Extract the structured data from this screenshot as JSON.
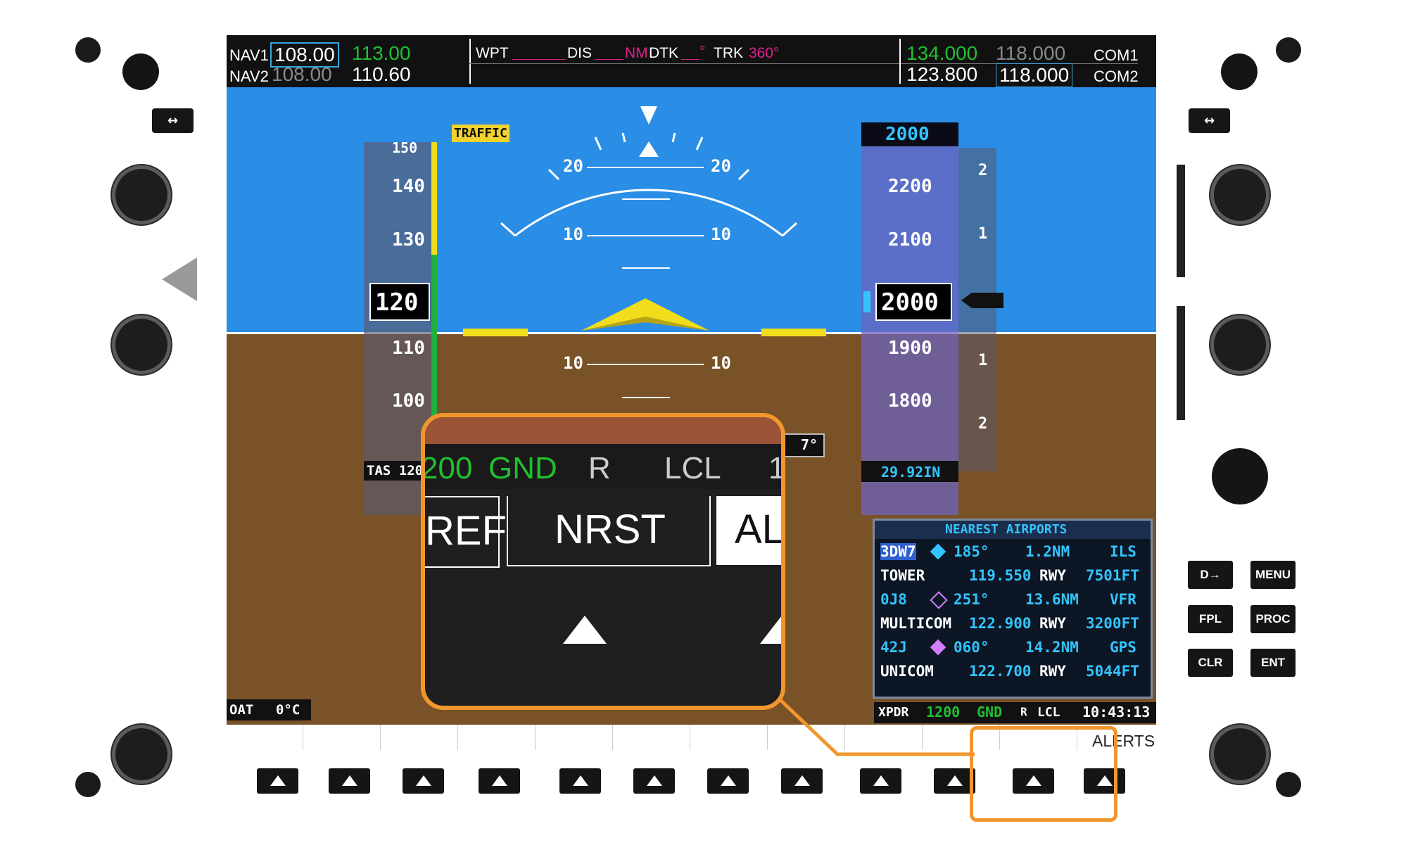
{
  "top_bar": {
    "nav1_label": "NAV1",
    "nav1_standby": "108.00",
    "nav1_active": "113.00",
    "nav2_label": "NAV2",
    "nav2_standby": "108.00",
    "nav2_active": "110.60",
    "wpt_label": "WPT",
    "dis_label": "DIS",
    "dis_unit": "NM",
    "dtk_label": "DTK",
    "dtk_unit": "°",
    "trk_label": "TRK",
    "trk_value": "360°",
    "com1_active": "134.000",
    "com1_standby": "118.000",
    "com1_label": "COM1",
    "com2_active": "123.800",
    "com2_standby": "118.000",
    "com2_label": "COM2"
  },
  "pfd": {
    "traffic_flag": "TRAFFIC",
    "airspeed": {
      "current": "120",
      "ticks": [
        "150",
        "140",
        "130",
        "110",
        "100"
      ],
      "tas_label": "TAS 120"
    },
    "pitch_labels": [
      "20",
      "20",
      "10",
      "10",
      "10",
      "10"
    ],
    "altitude": {
      "selected": "2000",
      "current": "2000",
      "ticks": [
        "2200",
        "2100",
        "1900",
        "1800"
      ],
      "vsi_marks": [
        "2",
        "1",
        "1",
        "2"
      ],
      "baro": "29.92IN"
    },
    "oat_label": "OAT",
    "oat_value": "0°C",
    "heading_partial": "7°",
    "transponder_bar": {
      "label": "XPDR",
      "code": "1200",
      "mode": "GND",
      "reply": "R",
      "time_mode": "LCL",
      "time": "10:43:13"
    }
  },
  "nearest_airports": {
    "title": "NEAREST AIRPORTS",
    "rows": [
      {
        "ident": "3DW7",
        "bearing": "185°",
        "distance": "1.2NM",
        "approach": "ILS",
        "freq_label": "TOWER",
        "freq": "119.550",
        "rwy": "RWY",
        "length": "7501FT"
      },
      {
        "ident": "0J8",
        "bearing": "251°",
        "distance": "13.6NM",
        "approach": "VFR",
        "freq_label": "MULTICOM",
        "freq": "122.900",
        "rwy": "RWY",
        "length": "3200FT"
      },
      {
        "ident": "42J",
        "bearing": "060°",
        "distance": "14.2NM",
        "approach": "GPS",
        "freq_label": "UNICOM",
        "freq": "122.700",
        "rwy": "RWY",
        "length": "5044FT"
      }
    ]
  },
  "softkey_label": "ALERTS",
  "bezel_keys": {
    "direct": "D→",
    "menu": "MENU",
    "fpl": "FPL",
    "proc": "PROC",
    "clr": "CLR",
    "ent": "ENT",
    "swap": "↔"
  },
  "zoom": {
    "status_code": "200",
    "status_mode": "GND",
    "status_reply": "R",
    "status_time_mode": "LCL",
    "status_time_partial": "1",
    "softkey_left": "REF",
    "softkey_center": "NRST",
    "softkey_right": "AL"
  },
  "colors": {
    "callout": "#f0962c",
    "sky": "#2a8ee7",
    "ground": "#7a5227",
    "active_freq": "#20c030",
    "magenta": "#e0208a",
    "tape_cyan": "#33c4ff"
  }
}
